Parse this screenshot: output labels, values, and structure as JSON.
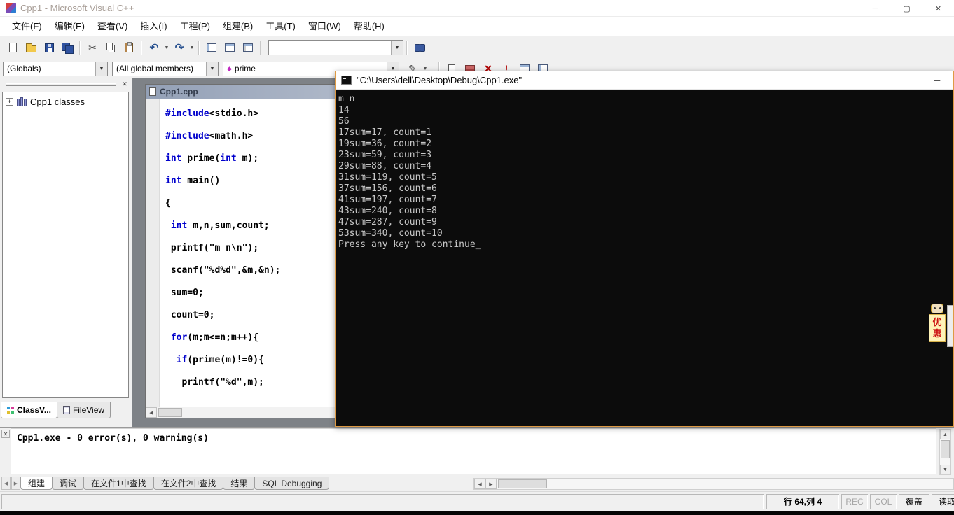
{
  "window": {
    "title": "Cpp1 - Microsoft Visual C++",
    "controls": {
      "minimize": "─",
      "maximize": "▢",
      "close": "✕"
    }
  },
  "menu": {
    "items": [
      "文件(F)",
      "编辑(E)",
      "查看(V)",
      "插入(I)",
      "工程(P)",
      "组建(B)",
      "工具(T)",
      "窗口(W)",
      "帮助(H)"
    ]
  },
  "toolbar1": {
    "find_value": "",
    "icons": [
      "new-file-icon",
      "open-file-icon",
      "save-icon",
      "save-all-icon",
      "cut-icon",
      "copy-icon",
      "paste-icon",
      "undo-icon",
      "redo-icon",
      "workspace-pane-icon",
      "output-pane-icon",
      "window-list-icon",
      "find-in-files-icon"
    ]
  },
  "wizardbar": {
    "scope": "(Globals)",
    "filter": "(All global members)",
    "member": "prime",
    "icons": [
      "wizard-actions-icon",
      "compile-icon",
      "build-icon",
      "stop-build-icon",
      "execute-program-icon",
      "go-icon",
      "breakpoint-icon"
    ]
  },
  "workspace": {
    "tree_root": "Cpp1 classes",
    "tabs": [
      {
        "label": "ClassV..."
      },
      {
        "label": "FileView"
      }
    ]
  },
  "editor": {
    "title": "Cpp1.cpp",
    "lines": [
      [
        {
          "t": "#include",
          "k": true
        },
        {
          "t": "<stdio.h>"
        }
      ],
      [
        {
          "t": "#include",
          "k": true
        },
        {
          "t": "<math.h>"
        }
      ],
      [
        {
          "t": "int",
          "k": true
        },
        {
          "t": " prime("
        },
        {
          "t": "int",
          "k": true
        },
        {
          "t": " m);"
        }
      ],
      [
        {
          "t": "int",
          "k": true
        },
        {
          "t": " main()"
        }
      ],
      [
        {
          "t": "{"
        }
      ],
      [
        {
          "t": " "
        },
        {
          "t": "int",
          "k": true
        },
        {
          "t": " m,n,sum,count;"
        }
      ],
      [
        {
          "t": " printf(\"m n\\n\");"
        }
      ],
      [
        {
          "t": " scanf(\"%d%d\",&m,&n);"
        }
      ],
      [
        {
          "t": " sum=0;"
        }
      ],
      [
        {
          "t": " count=0;"
        }
      ],
      [
        {
          "t": " "
        },
        {
          "t": "for",
          "k": true
        },
        {
          "t": "(m;m<=n;m++){"
        }
      ],
      [
        {
          "t": "  "
        },
        {
          "t": "if",
          "k": true
        },
        {
          "t": "(prime(m)!=0){"
        }
      ],
      [
        {
          "t": "   printf(\"%d\",m);"
        }
      ]
    ]
  },
  "console": {
    "title": "\"C:\\Users\\dell\\Desktop\\Debug\\Cpp1.exe\"",
    "lines": [
      "m n",
      "14",
      "56",
      "17sum=17, count=1",
      "19sum=36, count=2",
      "23sum=59, count=3",
      "29sum=88, count=4",
      "31sum=119, count=5",
      "37sum=156, count=6",
      "41sum=197, count=7",
      "43sum=240, count=8",
      "47sum=287, count=9",
      "53sum=340, count=10",
      "Press any key to continue"
    ],
    "cursor": "_",
    "minimize": "─"
  },
  "ad": {
    "label": "优惠"
  },
  "output": {
    "text": "Cpp1.exe - 0 error(s), 0 warning(s)",
    "tabs": [
      "组建",
      "调试",
      "在文件1中查找",
      "在文件2中查找",
      "结果",
      "SQL Debugging"
    ],
    "active_tab": "组建"
  },
  "statusbar": {
    "position": "行 64,列 4",
    "rec": "REC",
    "col": "COL",
    "overwrite": "覆盖",
    "read": "读取"
  }
}
